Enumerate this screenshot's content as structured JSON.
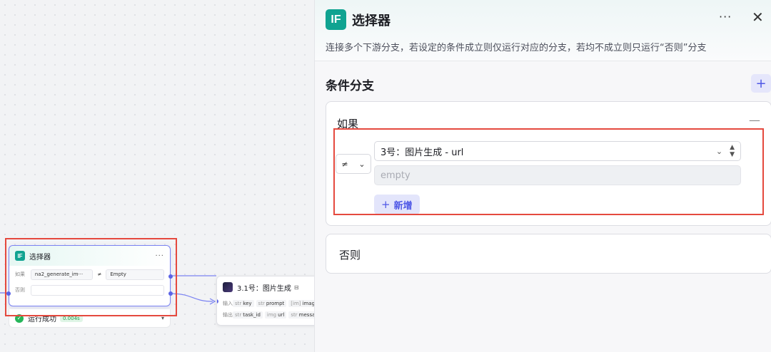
{
  "canvas": {
    "selector_node": {
      "title": "选择器",
      "more": "···",
      "if_label": "如果",
      "if_variable": "na2_generate_im···",
      "if_operator": "≠",
      "if_value": "Empty",
      "else_label": "否则"
    },
    "status": {
      "text": "运行成功",
      "duration": "0.004s"
    },
    "gen_node": {
      "title": "3.1号：图片生成",
      "input_label": "输入",
      "output_label": "输出",
      "inputs": [
        {
          "type": "str",
          "name": "key"
        },
        {
          "type": "str",
          "name": "prompt"
        },
        {
          "type": "[im]",
          "name": "imag"
        }
      ],
      "outputs": [
        {
          "type": "str",
          "name": "task_id"
        },
        {
          "type": "img",
          "name": "url"
        },
        {
          "type": "str",
          "name": "messa"
        }
      ]
    }
  },
  "panel": {
    "badge": "IF",
    "title": "选择器",
    "more": "···",
    "close": "✕",
    "description": "连接多个下游分支，若设定的条件成立则仅运行对应的分支，若均不成立则只运行“否则”分支",
    "section_title": "条件分支",
    "add_branch_icon": "+",
    "if_card": {
      "label": "如果",
      "collapse_icon": "—",
      "operator": "≠",
      "operator_chevron": "⌄",
      "variable": "3号：图片生成 - url",
      "variable_chevron": "⌄",
      "value_placeholder": "empty",
      "add_condition_label": "新增",
      "add_condition_icon": "+"
    },
    "else_card": {
      "label": "否则"
    }
  },
  "colors": {
    "accent": "#4e57e6",
    "badge": "#10a391",
    "highlight": "#e5493e",
    "success": "#26b65a"
  }
}
